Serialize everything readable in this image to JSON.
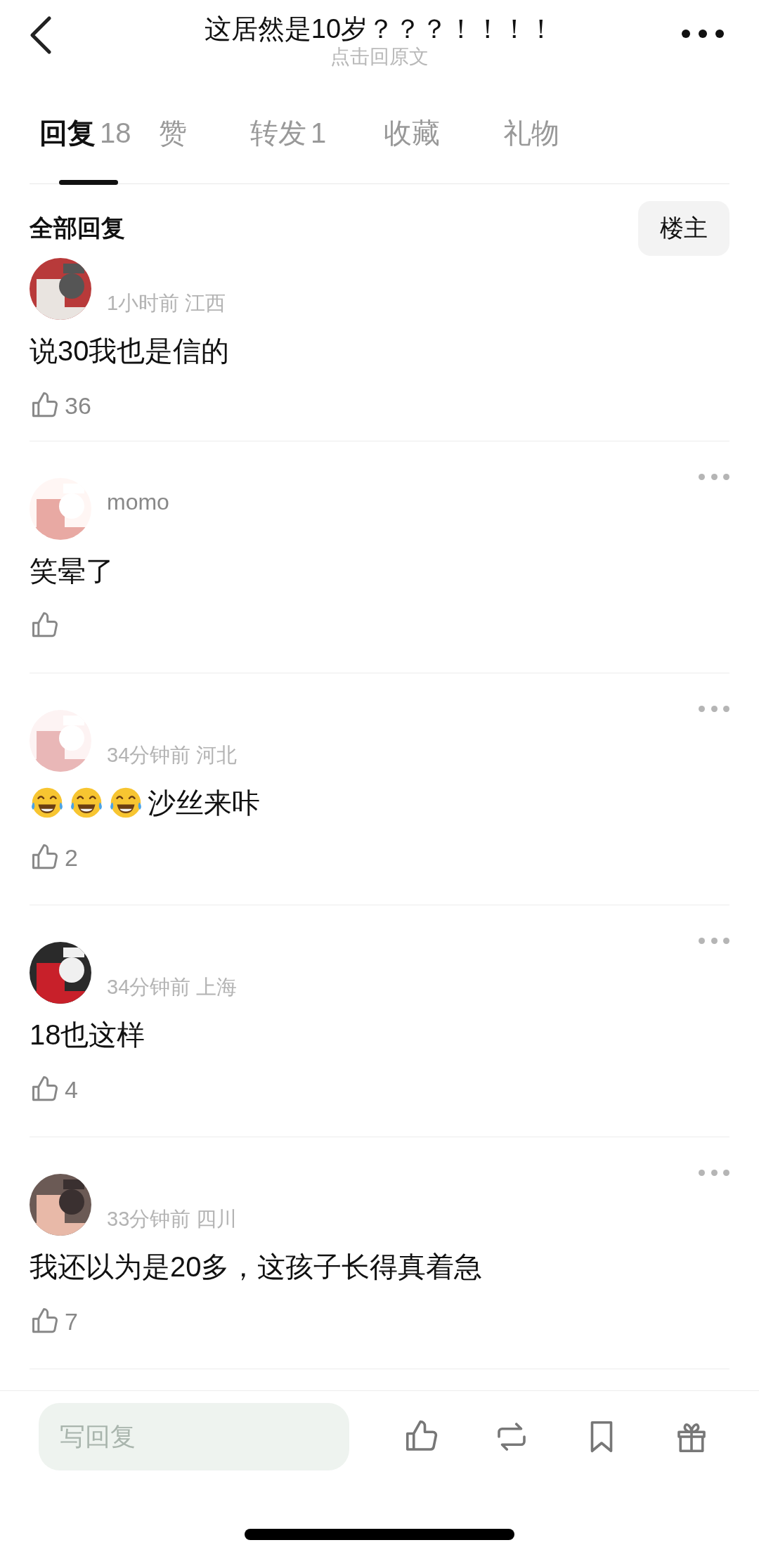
{
  "header": {
    "title": "这居然是10岁？？？！！！！",
    "subtitle": "点击回原文"
  },
  "tabs": [
    {
      "label": "回复",
      "count": "18",
      "selected": true
    },
    {
      "label": "赞",
      "selected": false
    },
    {
      "label": "转发",
      "count": "1",
      "selected": false
    },
    {
      "label": "收藏",
      "selected": false
    },
    {
      "label": "礼物",
      "selected": false
    }
  ],
  "section": {
    "title": "全部回复",
    "filter_button": "楼主"
  },
  "comments": [
    {
      "meta": "1小时前 江西",
      "content": [
        {
          "kind": "text",
          "text": "说30我也是信的"
        }
      ],
      "likes": "36",
      "has_more": false
    },
    {
      "name": "momo",
      "content": [
        {
          "kind": "text",
          "text": "笑晕了"
        }
      ],
      "has_more": true
    },
    {
      "meta": "34分钟前 河北",
      "content": [
        {
          "kind": "emoji"
        },
        {
          "kind": "emoji"
        },
        {
          "kind": "emoji"
        },
        {
          "kind": "text",
          "text": "沙丝来咔"
        }
      ],
      "likes": "2",
      "has_more": true
    },
    {
      "meta": "34分钟前 上海",
      "content": [
        {
          "kind": "text",
          "text": "18也这样"
        }
      ],
      "likes": "4",
      "has_more": true
    },
    {
      "meta": "33分钟前 四川",
      "content": [
        {
          "kind": "text",
          "text": "我还以为是20多，这孩子长得真着急"
        }
      ],
      "likes": "7",
      "has_more": true
    }
  ],
  "bottom_bar": {
    "placeholder": "写回复"
  }
}
